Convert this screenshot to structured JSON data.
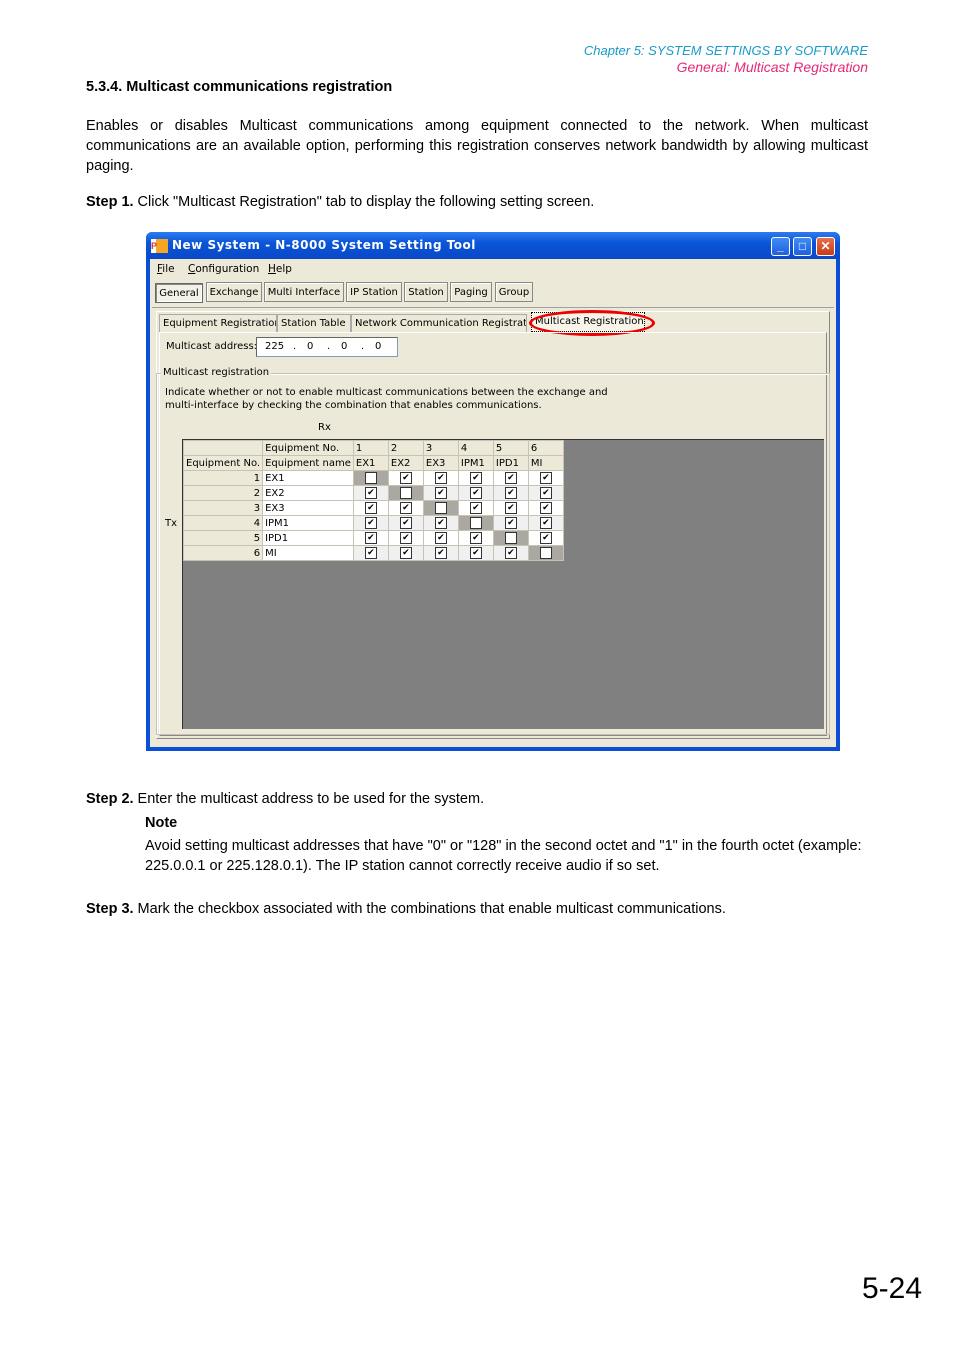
{
  "header": {
    "chapter": "Chapter 5:  SYSTEM SETTINGS BY SOFTWARE",
    "section": "General: Multicast Registration"
  },
  "section_title": "5.3.4. Multicast communications registration",
  "intro": "Enables or disables Multicast communications among equipment connected to the network. When multicast communications are an available option, performing this registration conserves network bandwidth by allowing multicast paging.",
  "step1": {
    "label": "Step 1.",
    "text": "Click \"Multicast Registration\" tab to display the following setting screen."
  },
  "step2": {
    "label": "Step 2.",
    "text": "Enter the multicast address to be used for the system."
  },
  "note": {
    "title": "Note",
    "text": "Avoid setting multicast addresses that have \"0\" or \"128\" in the second octet and \"1\" in the fourth octet (example: 225.0.0.1 or 225.128.0.1). The IP station cannot correctly receive audio if so set."
  },
  "step3": {
    "label": "Step 3.",
    "text": "Mark the checkbox associated with the combinations that enable multicast communications."
  },
  "page_number": "5-24",
  "window": {
    "title": "New System - N-8000 System Setting Tool",
    "icon": "app-logo-icon",
    "controls": {
      "minimize": "_",
      "maximize": "□",
      "close": "✕"
    },
    "menu": [
      "File",
      "Configuration",
      "Help"
    ],
    "tabs": [
      "General",
      "Exchange",
      "Multi Interface",
      "IP Station",
      "Station",
      "Paging",
      "Group"
    ],
    "active_tab": "General",
    "subtabs": [
      "Equipment Registration",
      "Station Table",
      "Network Communication Registration",
      "Multicast Registration"
    ],
    "active_subtab": "Multicast Registration",
    "multicast_address_label": "Multicast address:",
    "multicast_address": [
      "225",
      "0",
      "0",
      "0"
    ],
    "octet_sep": ".",
    "group_title": "Multicast registration",
    "instructions_line1": "Indicate whether or not to enable multicast communications between the exchange and",
    "instructions_line2": "multi-interface by checking the combination that enables communications.",
    "rx_label": "Rx",
    "tx_label": "Tx",
    "grid": {
      "header_row1_label": "Equipment No.",
      "header_row2_left": "Equipment No.",
      "header_row2_label": "Equipment name",
      "columns": [
        {
          "no": "1",
          "name": "EX1"
        },
        {
          "no": "2",
          "name": "EX2"
        },
        {
          "no": "3",
          "name": "EX3"
        },
        {
          "no": "4",
          "name": "IPM1"
        },
        {
          "no": "5",
          "name": "IPD1"
        },
        {
          "no": "6",
          "name": "MI"
        }
      ],
      "rows": [
        {
          "no": "1",
          "name": "EX1",
          "checks": [
            false,
            true,
            true,
            true,
            true,
            true
          ]
        },
        {
          "no": "2",
          "name": "EX2",
          "checks": [
            true,
            false,
            true,
            true,
            true,
            true
          ]
        },
        {
          "no": "3",
          "name": "EX3",
          "checks": [
            true,
            true,
            false,
            true,
            true,
            true
          ]
        },
        {
          "no": "4",
          "name": "IPM1",
          "checks": [
            true,
            true,
            true,
            false,
            true,
            true
          ]
        },
        {
          "no": "5",
          "name": "IPD1",
          "checks": [
            true,
            true,
            true,
            true,
            false,
            true
          ]
        },
        {
          "no": "6",
          "name": "MI",
          "checks": [
            true,
            true,
            true,
            true,
            true,
            false
          ]
        }
      ]
    }
  }
}
